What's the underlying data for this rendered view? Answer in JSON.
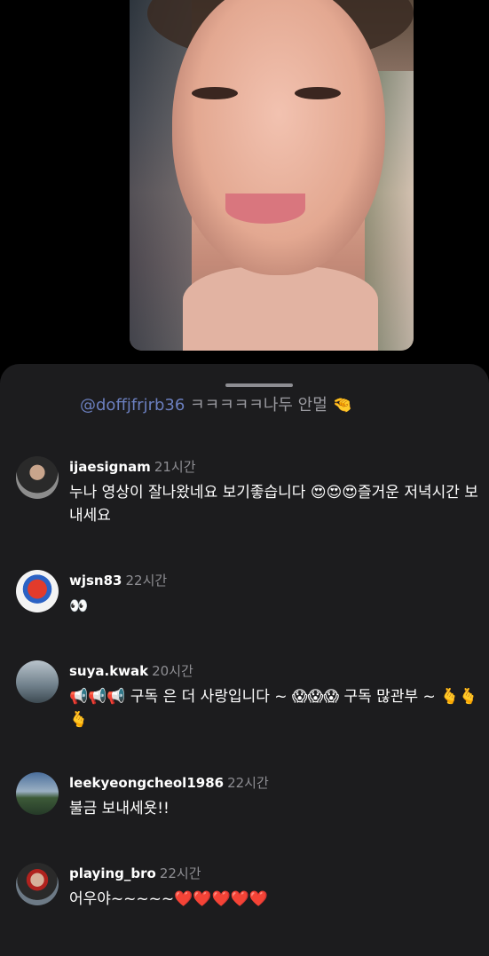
{
  "pinned": {
    "mention": "@doffjfrjrb36",
    "text": " ㅋㅋㅋㅋㅋ나두 안멀 🤏"
  },
  "comments": [
    {
      "username": "ijaesignam",
      "time": "21시간",
      "text": "누나 영상이 잘나왔네요 보기좋습니다 😍😍😍즐거운 저녁시간 보내세요"
    },
    {
      "username": "wjsn83",
      "time": "22시간",
      "text": "👀"
    },
    {
      "username": "suya.kwak",
      "time": "20시간",
      "text": "📢📢📢 구독 은 더 사랑입니다 ~ 😱😱😱 구독 많관부 ~ 🫰🫰🫰"
    },
    {
      "username": "leekyeongcheol1986",
      "time": "22시간",
      "text": "불금 보내세욧!!"
    },
    {
      "username": "playing_bro",
      "time": "22시간",
      "text": "어우야~~~~~❤️❤️❤️❤️❤️"
    }
  ]
}
